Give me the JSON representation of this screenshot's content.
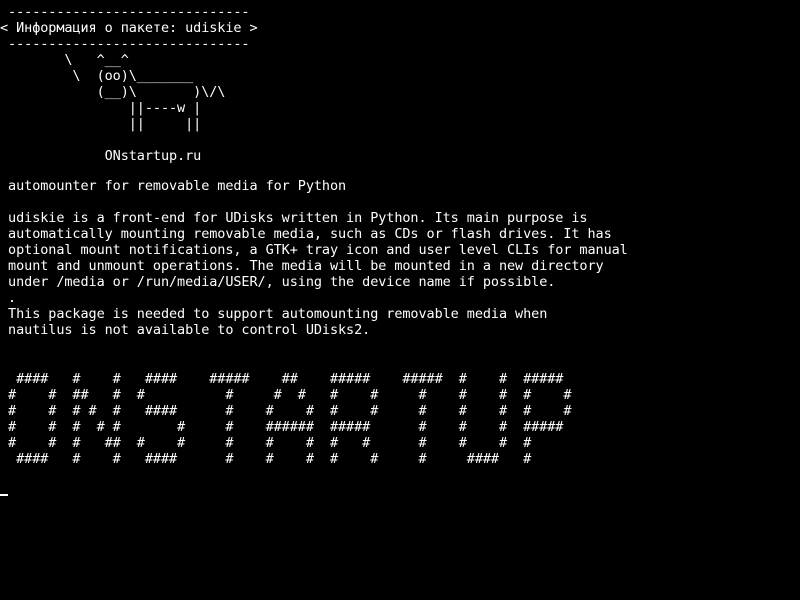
{
  "colors": {
    "background": "#000000",
    "foreground": "#ffffff"
  },
  "terminal": {
    "cowsay": " ------------------------------\n< Информация о пакете: udiskie >\n ------------------------------\n        \\   ^__^\n         \\  (oo)\\_______\n            (__)\\       )\\/\\\n                ||----w |\n                ||     ||\n\n             ONstartup.ru",
    "summary": " automounter for removable media for Python",
    "description": " udiskie is a front-end for UDisks written in Python. Its main purpose is\n automatically mounting removable media, such as CDs or flash drives. It has\n optional mount notifications, a GTK+ tray icon and user level CLIs for manual\n mount and unmount operations. The media will be mounted in a new directory\n under /media or /run/media/USER/, using the device name if possible.\n .\n This package is needed to support automounting removable media when\n nautilus is not available to control UDisks2.",
    "figlet": "  ####   #    #   ####    #####    ##    #####    #####  #    #  #####\n #    #  ##   #  #          #     #  #   #    #     #    #    #  #    #\n #    #  # #  #   ####      #    #    #  #    #     #    #    #  #    #\n #    #  #  # #       #     #    ######  #####      #    #    #  #####\n #    #  #   ##  #    #     #    #    #  #   #      #    #    #  #\n  ####   #    #   ####      #    #    #  #    #     #     ####   #"
  }
}
